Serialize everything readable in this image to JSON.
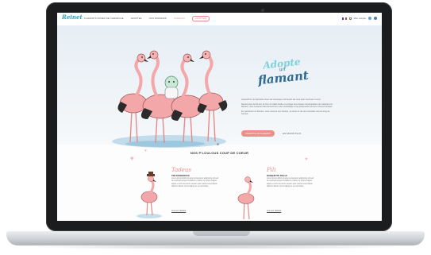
{
  "app": {
    "logo_text": "Reinet"
  },
  "nav": {
    "items": [
      {
        "label": "FLAMANTS ROSES DE CAMARGUE",
        "style": "normal"
      },
      {
        "label": "ADOPTEZ",
        "style": "normal"
      },
      {
        "label": "NOS PARRAINS",
        "style": "normal"
      },
      {
        "label": "CADEAUX",
        "style": "accent"
      },
      {
        "label": "ADOPTER",
        "style": "outlined"
      }
    ],
    "account_label": "Mon compte"
  },
  "hero": {
    "title_line1": "Adopte",
    "title_line2": "un",
    "title_line3": "flamant",
    "paragraphs": [
      "Aujourd'hui, les flamants roses de Camargue ont besoin de vous pour continuer à vivre.",
      "Depuis plus de 40 ans, la Tour du Valat étudie et protège ces oiseaux remarquables. En adoptant un flamant, vous soutenez directement leur suivi scientifique et la préservation de leurs zones humides.",
      "En parrainant un flamant, vous recevez son histoire, sa photo et de ses nouvelles tout au long de l'année."
    ],
    "cta_label": "J'ADOPTE UN FLAMANT",
    "secondary_label": "EN SAVOIR PLUS"
  },
  "section": {
    "title": "NOS P'LOULOUS COUP DE COEUR",
    "cards": [
      {
        "name": "Tadeus",
        "subtitle": "TEN DANGEROUS",
        "description": "Lorem ipsum dolor sit amet consectetur adipiscing elit sed do eiusmod tempor incididunt ut labore et dolore magna aliqua ut enim ad minim veniam quis nostrud exercitation ullamco laboris nisi ut aliquip ex ea commodo.",
        "link_label": "Lire son histoire"
      },
      {
        "name": "Pili",
        "subtitle": "BANQUETTE PAILLE",
        "description": "Lorem ipsum dolor sit amet consectetur adipiscing elit sed do eiusmod tempor incididunt ut labore et dolore magna aliqua ut enim ad minim veniam quis nostrud exercitation ullamco laboris nisi ut aliquip ex ea commodo.",
        "link_label": "Lire son histoire"
      }
    ]
  },
  "colors": {
    "accent_pink": "#ec8f8a",
    "brand_teal": "#2ea3b8",
    "title_blue": "#2e6a91"
  },
  "icons": [
    "flag-icon",
    "cart-icon",
    "social-icon",
    "heart-icon",
    "flamingo-illustration"
  ]
}
